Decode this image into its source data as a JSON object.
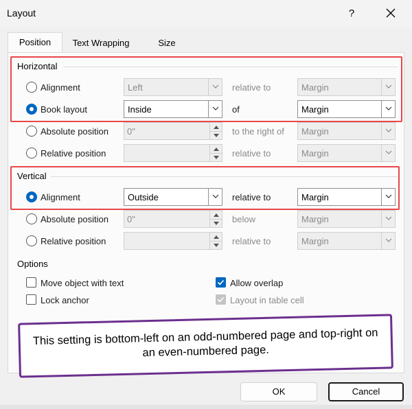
{
  "window": {
    "title": "Layout",
    "help": "?"
  },
  "tabs": [
    {
      "label": "Position",
      "active": true
    },
    {
      "label": "Text Wrapping",
      "active": false
    },
    {
      "label": "Size",
      "active": false
    }
  ],
  "horizontal": {
    "heading": "Horizontal",
    "alignment": {
      "label": "Alignment",
      "value": "Left",
      "relation": "relative to",
      "target": "Margin",
      "checked": false
    },
    "book_layout": {
      "label": "Book layout",
      "value": "Inside",
      "relation": "of",
      "target": "Margin",
      "checked": true
    },
    "absolute": {
      "label": "Absolute position",
      "value": "0\"",
      "relation": "to the right of",
      "target": "Margin",
      "checked": false
    },
    "relative": {
      "label": "Relative position",
      "value": "",
      "relation": "relative to",
      "target": "Margin",
      "checked": false
    }
  },
  "vertical": {
    "heading": "Vertical",
    "alignment": {
      "label": "Alignment",
      "value": "Outside",
      "relation": "relative to",
      "target": "Margin",
      "checked": true
    },
    "absolute": {
      "label": "Absolute position",
      "value": "0\"",
      "relation": "below",
      "target": "Margin",
      "checked": false
    },
    "relative": {
      "label": "Relative position",
      "value": "",
      "relation": "relative to",
      "target": "Margin",
      "checked": false
    }
  },
  "options": {
    "heading": "Options",
    "move_with_text": {
      "label": "Move object with text",
      "checked": false
    },
    "lock_anchor": {
      "label": "Lock anchor",
      "checked": false
    },
    "allow_overlap": {
      "label": "Allow overlap",
      "checked": true
    },
    "layout_in_cell": {
      "label": "Layout in table cell",
      "checked": true,
      "disabled": true
    }
  },
  "callout": {
    "text": "This setting is bottom-left on an odd-numbered page and top-right on an even-numbered page."
  },
  "buttons": {
    "ok": "OK",
    "cancel": "Cancel"
  },
  "colors": {
    "accent": "#0067c0",
    "highlight": "#e8474a",
    "callout_border": "#6b2f8e"
  },
  "icons": {
    "close": "close-icon",
    "dropdown": "chevron-down-icon",
    "spin": "spin-arrows-icon",
    "check": "check-icon"
  }
}
